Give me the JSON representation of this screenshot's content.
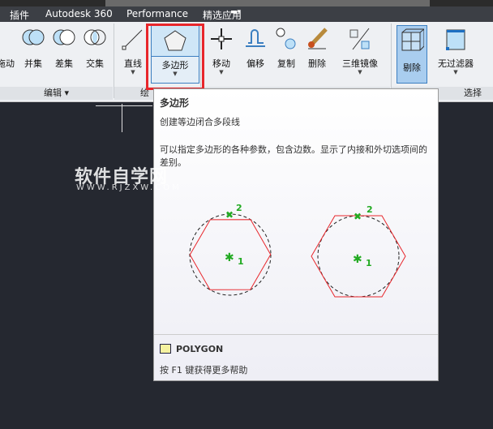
{
  "menu": {
    "tabs": [
      "插件",
      "Autodesk 360",
      "Performance",
      "精选应用"
    ]
  },
  "ribbon": {
    "buttons": [
      {
        "label": "拖动",
        "icon": "drag-icon"
      },
      {
        "label": "并集",
        "icon": "union-icon"
      },
      {
        "label": "差集",
        "icon": "subtract-icon"
      },
      {
        "label": "交集",
        "icon": "intersect-icon"
      },
      {
        "label": "直线",
        "icon": "line-icon"
      },
      {
        "label": "多边形",
        "icon": "polygon-icon"
      },
      {
        "label": "移动",
        "icon": "move-icon"
      },
      {
        "label": "偏移",
        "icon": "offset-icon"
      },
      {
        "label": "复制",
        "icon": "copy-icon"
      },
      {
        "label": "删除",
        "icon": "erase-icon"
      },
      {
        "label": "三维镜像",
        "icon": "mirror3d-icon"
      },
      {
        "label": "剔除",
        "icon": "culling-icon"
      },
      {
        "label": "无过滤器",
        "icon": "no-filter-icon"
      }
    ],
    "panels": [
      "编辑",
      "绘",
      "选择"
    ]
  },
  "tooltip": {
    "title": "多边形",
    "subtitle": "创建等边闭合多段线",
    "description": "可以指定多边形的各种参数，包含边数。显示了内接和外切选项间的差别。",
    "point1": "1",
    "point2": "2",
    "command": "POLYGON",
    "help": "按 F1 键获得更多帮助"
  },
  "watermark": {
    "line1": "软件自学网",
    "line2": "WWW.RJZXW.COM"
  },
  "colors": {
    "highlight": "#e8262b",
    "hexagon": "#e8262b",
    "marker": "#22aa22"
  }
}
